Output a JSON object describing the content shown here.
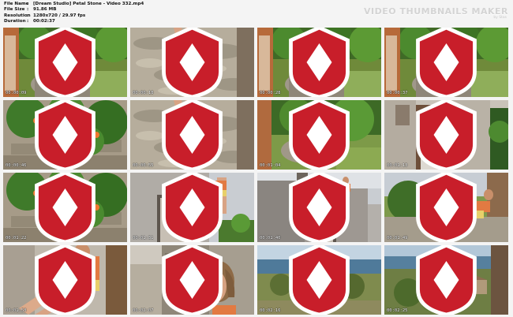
{
  "file_info": {
    "rows": [
      {
        "key": "File Name",
        "sep": ":",
        "value": "[Dream Studio] Petal Stone - Video 332.mp4"
      },
      {
        "key": "File Size",
        "sep": ":",
        "value": "91.86 MB"
      },
      {
        "key": "Resolution",
        "sep": ":",
        "value": "1280x720 / 29.97 fps"
      },
      {
        "key": "Duration",
        "sep": ":",
        "value": "00:02:37"
      }
    ]
  },
  "brand": {
    "title": "VIDEO THUMBNAILS MAKER",
    "subtitle": "by Stas"
  },
  "thumbnails": [
    {
      "timestamp": "00:00:09",
      "scene": "wall-garden-sitting"
    },
    {
      "timestamp": "00:00:18",
      "scene": "feet-stone"
    },
    {
      "timestamp": "00:00:28",
      "scene": "wall-garden-sitting"
    },
    {
      "timestamp": "00:00:37",
      "scene": "wall-garden-sitting"
    },
    {
      "timestamp": "00:00:46",
      "scene": "flowers-wall"
    },
    {
      "timestamp": "00:00:55",
      "scene": "feet-stone"
    },
    {
      "timestamp": "00:01:04",
      "scene": "wall-garden-standing"
    },
    {
      "timestamp": "00:01:13",
      "scene": "doorway"
    },
    {
      "timestamp": "00:01:22",
      "scene": "flowers-wall"
    },
    {
      "timestamp": "00:01:31",
      "scene": "building-window"
    },
    {
      "timestamp": "00:01:40",
      "scene": "building-sky"
    },
    {
      "timestamp": "00:01:49",
      "scene": "sitting-rock"
    },
    {
      "timestamp": "00:01:58",
      "scene": "closeup-sitting"
    },
    {
      "timestamp": "00:02:07",
      "scene": "portrait-wall"
    },
    {
      "timestamp": "00:02:16",
      "scene": "sea-view"
    },
    {
      "timestamp": "00:02:25",
      "scene": "sea-village"
    }
  ],
  "colors": {
    "background": "#f4f4f4",
    "brand_text": "#d4d4d4",
    "logo_red": "#c81e2a"
  }
}
